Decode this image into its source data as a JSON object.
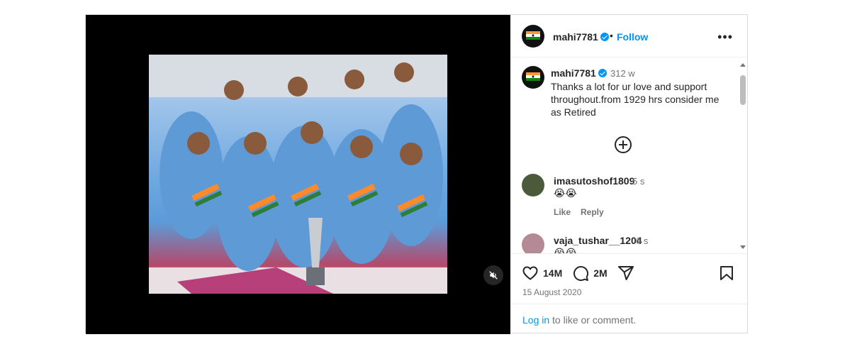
{
  "post": {
    "username": "mahi7781",
    "follow_label": "Follow",
    "separator": "•",
    "more_label": "•••"
  },
  "caption": {
    "username": "mahi7781",
    "time": "312 w",
    "text": "Thanks a lot for ur love and support throughout.from 1929 hrs consider me as Retired"
  },
  "comments": [
    {
      "username": "imasutoshof1809",
      "time": "5 s",
      "text": "😭😭",
      "like_label": "Like",
      "reply_label": "Reply"
    },
    {
      "username": "vaja_tushar__1204",
      "time": "6 s",
      "text": "😭😭"
    }
  ],
  "stats": {
    "likes": "14M",
    "comments": "2M"
  },
  "date": "15 August 2020",
  "login": {
    "link": "Log in",
    "rest": " to like or comment."
  },
  "colors": {
    "accent": "#0095f6",
    "muted": "#737373"
  },
  "icons": [
    "mute-icon",
    "heart-icon",
    "comment-icon",
    "share-icon",
    "save-icon",
    "verified-icon",
    "more-icon",
    "load-more-icon"
  ]
}
